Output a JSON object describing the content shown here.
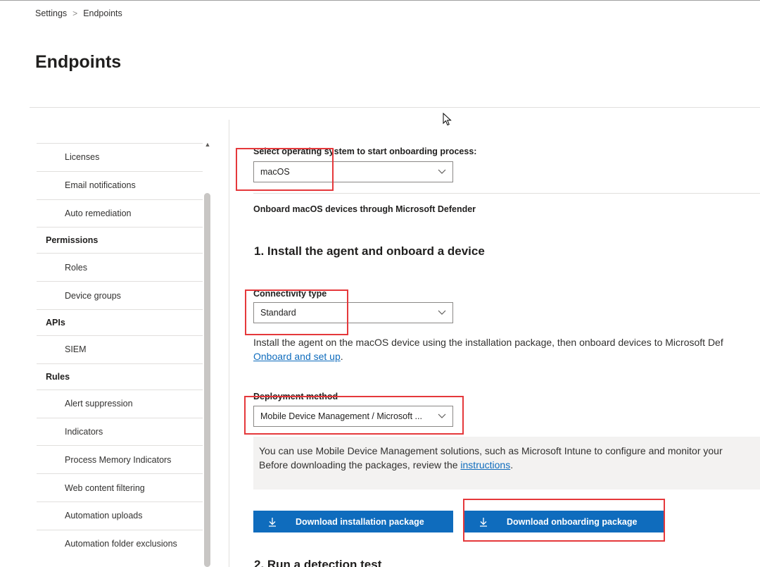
{
  "breadcrumb": {
    "root": "Settings",
    "current": "Endpoints"
  },
  "page": {
    "title": "Endpoints"
  },
  "sidebar": {
    "items": [
      {
        "type": "item",
        "label": "Licenses"
      },
      {
        "type": "item",
        "label": "Email notifications"
      },
      {
        "type": "item",
        "label": "Auto remediation"
      },
      {
        "type": "header",
        "label": "Permissions"
      },
      {
        "type": "item",
        "label": "Roles"
      },
      {
        "type": "item",
        "label": "Device groups"
      },
      {
        "type": "header",
        "label": "APIs"
      },
      {
        "type": "item",
        "label": "SIEM"
      },
      {
        "type": "header",
        "label": "Rules"
      },
      {
        "type": "item",
        "label": "Alert suppression"
      },
      {
        "type": "item",
        "label": "Indicators"
      },
      {
        "type": "item",
        "label": "Process Memory Indicators"
      },
      {
        "type": "item",
        "label": "Web content filtering"
      },
      {
        "type": "item",
        "label": "Automation uploads"
      },
      {
        "type": "item",
        "label": "Automation folder exclusions"
      }
    ]
  },
  "onboarding": {
    "os_label": "Select operating system to start onboarding process:",
    "os_value": "macOS",
    "description": "Onboard macOS devices through Microsoft Defender",
    "step1_title": "1. Install the agent and onboard a device",
    "connectivity_label": "Connectivity type",
    "connectivity_value": "Standard",
    "install_text": "Install the agent on the macOS device using the installation package, then onboard devices to Microsoft Def",
    "install_link": "Onboard and set up",
    "install_link_suffix": ".",
    "deployment_label": "Deployment method",
    "deployment_value": "Mobile Device Management / Microsoft ...",
    "info_line1": "You can use Mobile Device Management solutions, such as Microsoft Intune to configure and monitor your",
    "info_line2_prefix": "Before downloading the packages, review the ",
    "info_link": "instructions",
    "info_line2_suffix": ".",
    "btn_install": "Download installation package",
    "btn_onboard": "Download onboarding package",
    "step2_title": "2. Run a detection test"
  },
  "colors": {
    "accent": "#0f6cbd",
    "highlight": "#e5383b"
  },
  "icons": {
    "chevron": "chevron-down-icon",
    "download": "download-icon",
    "cursor": "mouse-pointer-icon"
  }
}
